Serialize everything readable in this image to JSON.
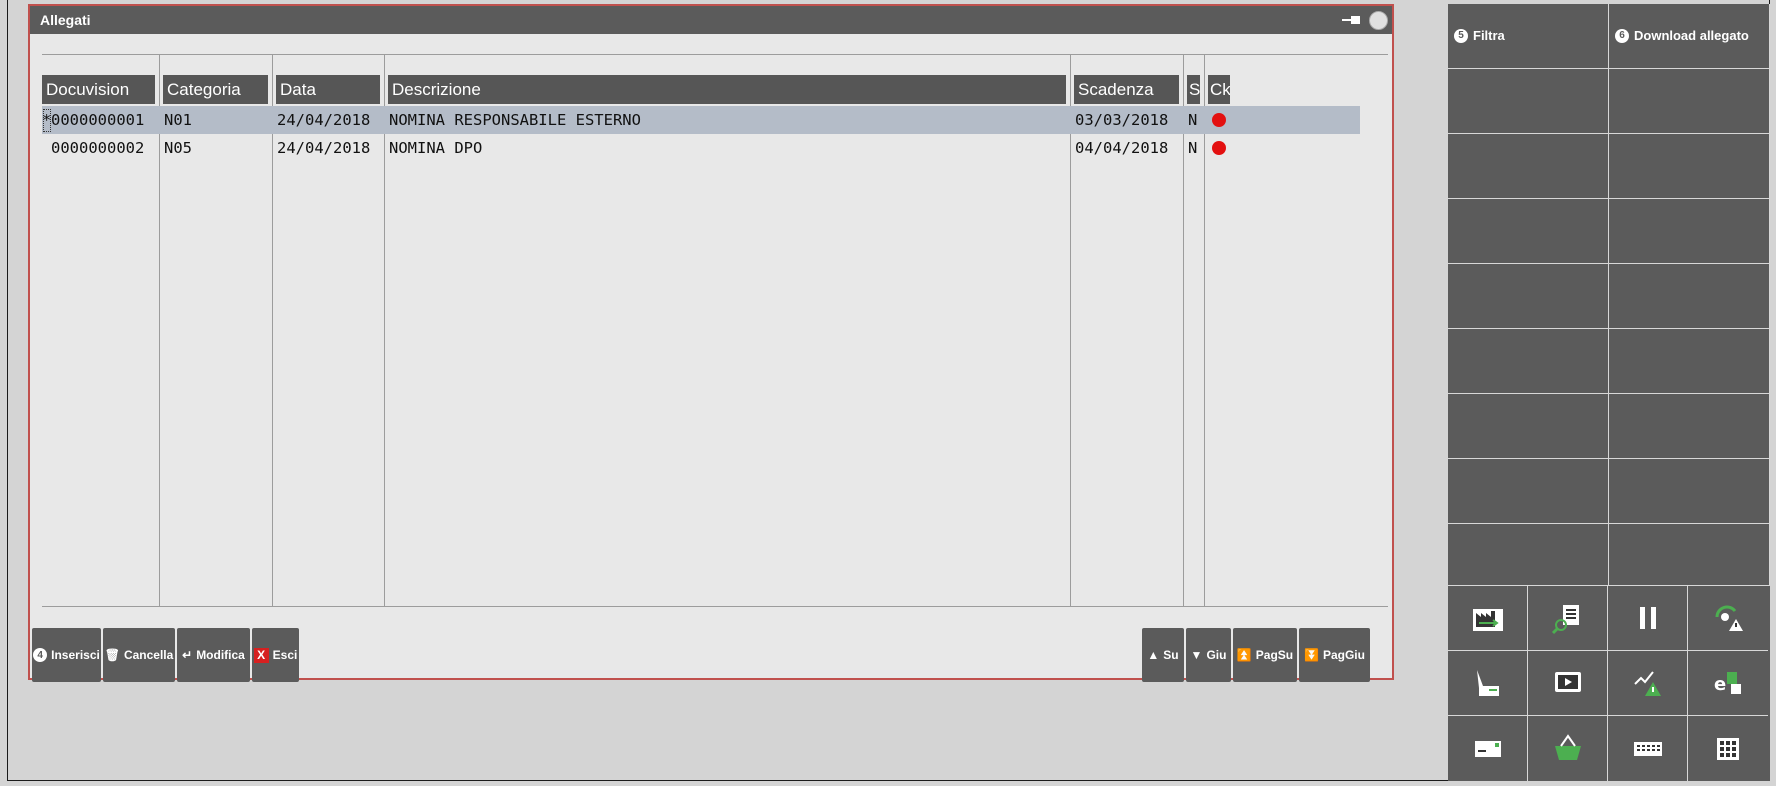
{
  "dialog": {
    "title": "Allegati",
    "columns": [
      "Docuvision",
      "Categoria",
      "Data",
      "Descrizione",
      "Scadenza",
      "S",
      "Ck"
    ],
    "rows": [
      {
        "marker": "*",
        "docuvision": "0000000001",
        "categoria": "N01",
        "data": "24/04/2018",
        "descrizione": "NOMINA RESPONSABILE ESTERNO",
        "scadenza": "03/03/2018",
        "s": "N",
        "ck_color": "#e31010"
      },
      {
        "marker": "",
        "docuvision": "0000000002",
        "categoria": "N05",
        "data": "24/04/2018",
        "descrizione": "NOMINA DPO",
        "scadenza": "04/04/2018",
        "s": "N",
        "ck_color": "#e31010"
      }
    ],
    "buttons_left": [
      {
        "key": "4",
        "label": "Inserisci"
      },
      {
        "key": "trash",
        "label": "Cancella"
      },
      {
        "key": "enter",
        "label": "Modifica"
      },
      {
        "key": "X",
        "label": "Esci"
      }
    ],
    "buttons_right": [
      {
        "icon": "arrow-up",
        "label": "Su"
      },
      {
        "icon": "arrow-down",
        "label": "Giu"
      },
      {
        "icon": "page-up",
        "label": "PagSu"
      },
      {
        "icon": "page-down",
        "label": "PagGiu"
      }
    ]
  },
  "right_panel": {
    "filtra": {
      "key": "5",
      "label": "Filtra"
    },
    "download": {
      "key": "6",
      "label": "Download allegato"
    },
    "icon_buttons": [
      "factory-icon",
      "search-document-icon",
      "pause-icon",
      "refresh-warning-icon",
      "pen-card-icon",
      "screen-icon",
      "chart-warning-icon",
      "ep-lock-icon",
      "envelope-icon",
      "basket-icon",
      "keyboard-icon",
      "calculator-grid-icon"
    ]
  },
  "colors": {
    "selected_row": "#b4bcc8",
    "dialog_border": "#c0504d",
    "panel": "#5b5b5b",
    "status_dot": "#e31010"
  }
}
